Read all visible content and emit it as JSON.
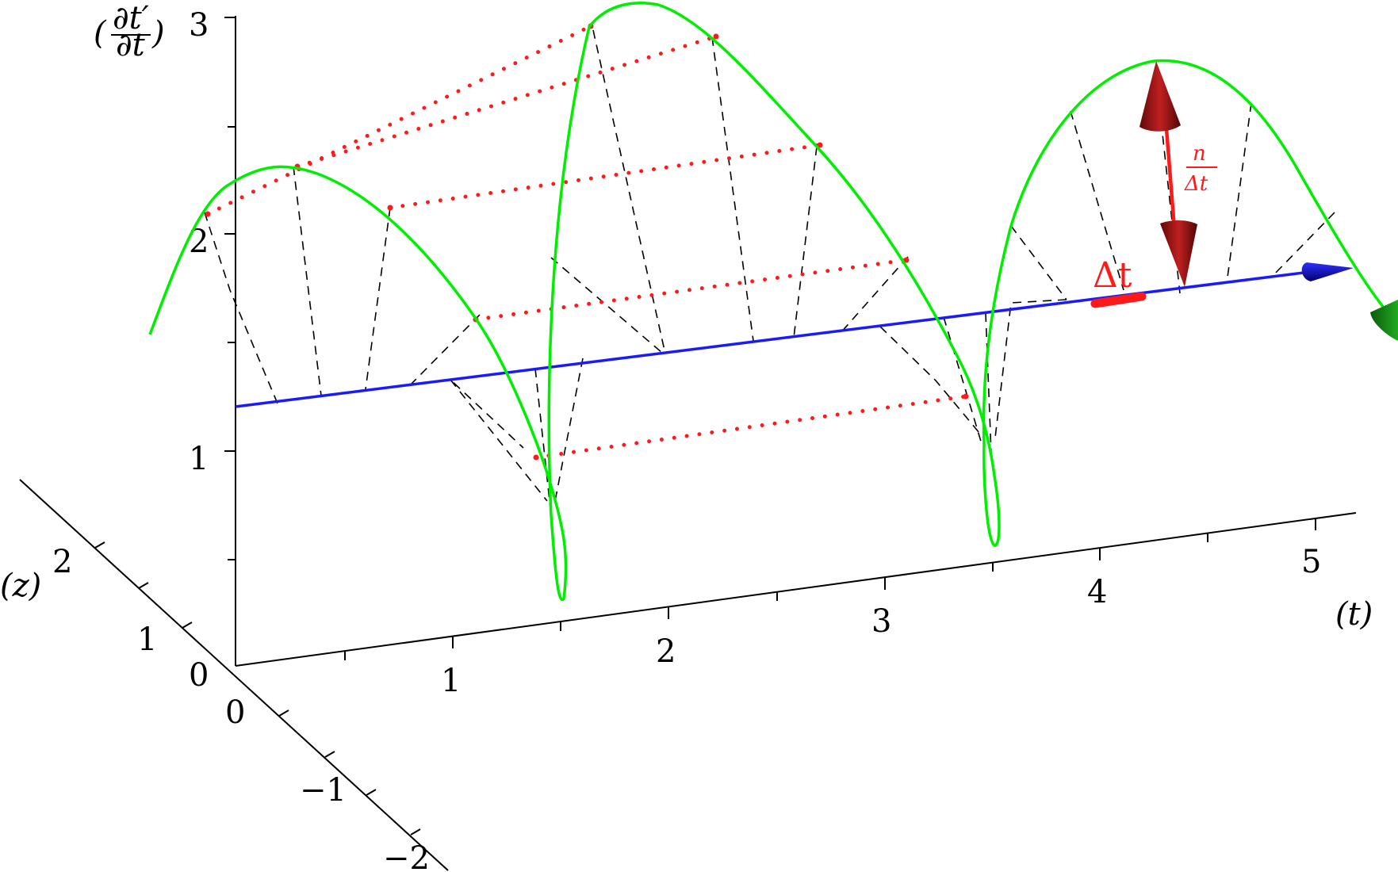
{
  "axes": {
    "vertical": {
      "label": "(∂t′/∂t)",
      "ticks": [
        "1",
        "2",
        "3"
      ]
    },
    "horizontal": {
      "label": "(t)",
      "ticks": [
        "1",
        "2",
        "3",
        "4",
        "5"
      ]
    },
    "depth": {
      "label": "(z)",
      "ticks_pos": [
        "1",
        "2"
      ],
      "ticks_neg": [
        "0",
        "−1",
        "−2"
      ],
      "origin_tick": "0"
    }
  },
  "annotations": {
    "delta_t": "Δt",
    "ratio_num": "n",
    "ratio_den": "Δt"
  },
  "colors": {
    "curve": "#00ee00",
    "time_axis": "#1a1aff",
    "highlight": "#ff1a1a",
    "dashed": "#000000",
    "arrow_head_red": "#b01010",
    "arrow_head_blue": "#0a0aa0",
    "arrow_head_green": "#0b7a0b"
  }
}
